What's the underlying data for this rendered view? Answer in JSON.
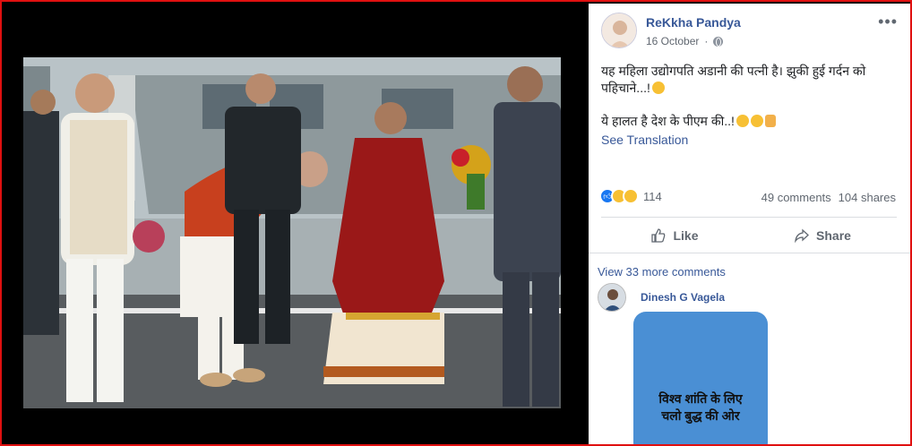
{
  "post": {
    "author": "ReKkha Pandya",
    "date": "16 October",
    "text_line1": "यह महिला उद्योगपति अडानी की पत्नी है। झुकी हुई गर्दन को पहिचाने...!",
    "text_line2": "ये हालत है देश के पीएम की..!",
    "see_translation": "See Translation",
    "reaction_count": "114",
    "comments_count": "49 comments",
    "shares_count": "104 shares",
    "like_label": "Like",
    "share_label": "Share"
  },
  "comments": {
    "view_more": "View 33 more comments",
    "first_commenter": "Dinesh G Vagela",
    "image_text_line1": "विश्व शांति के लिए",
    "image_text_line2": "चलो बुद्ध की ओर"
  },
  "icons": {
    "more": "more-options-icon",
    "globe": "globe-icon",
    "like": "thumbs-up-icon",
    "share": "share-arrow-icon"
  },
  "colors": {
    "link": "#385898",
    "frame_border": "#e01010",
    "comment_image_bg": "#4a8fd4"
  }
}
